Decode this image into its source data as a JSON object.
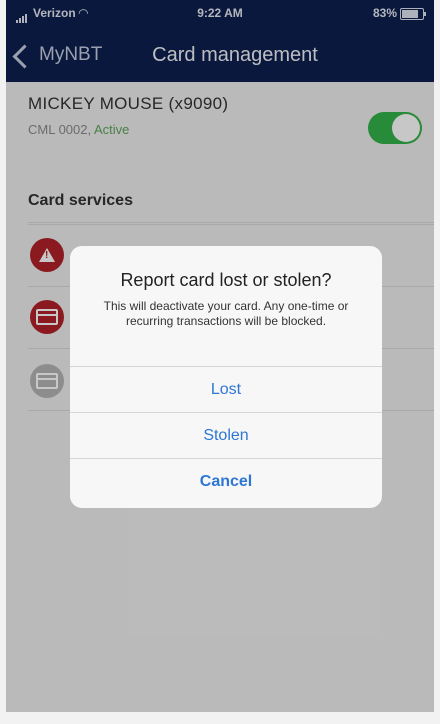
{
  "status_bar": {
    "carrier": "Verizon",
    "time": "9:22 AM",
    "battery": "83%"
  },
  "nav": {
    "back_label": "MyNBT",
    "title": "Card management"
  },
  "card": {
    "name": "MICKEY MOUSE (x9090)",
    "code": "CML 0002,",
    "status": "Active",
    "enabled": true
  },
  "section": {
    "title": "Card services"
  },
  "dialog": {
    "title": "Report card lost or stolen?",
    "message": "This will deactivate your card. Any one-time or recurring transactions will be blocked.",
    "buttons": {
      "lost": "Lost",
      "stolen": "Stolen",
      "cancel": "Cancel"
    }
  },
  "colors": {
    "nav_bg": "#0d1f4f",
    "toggle_on": "#34b24b",
    "service_red": "#b3222a",
    "dialog_button": "#2d76d6"
  }
}
